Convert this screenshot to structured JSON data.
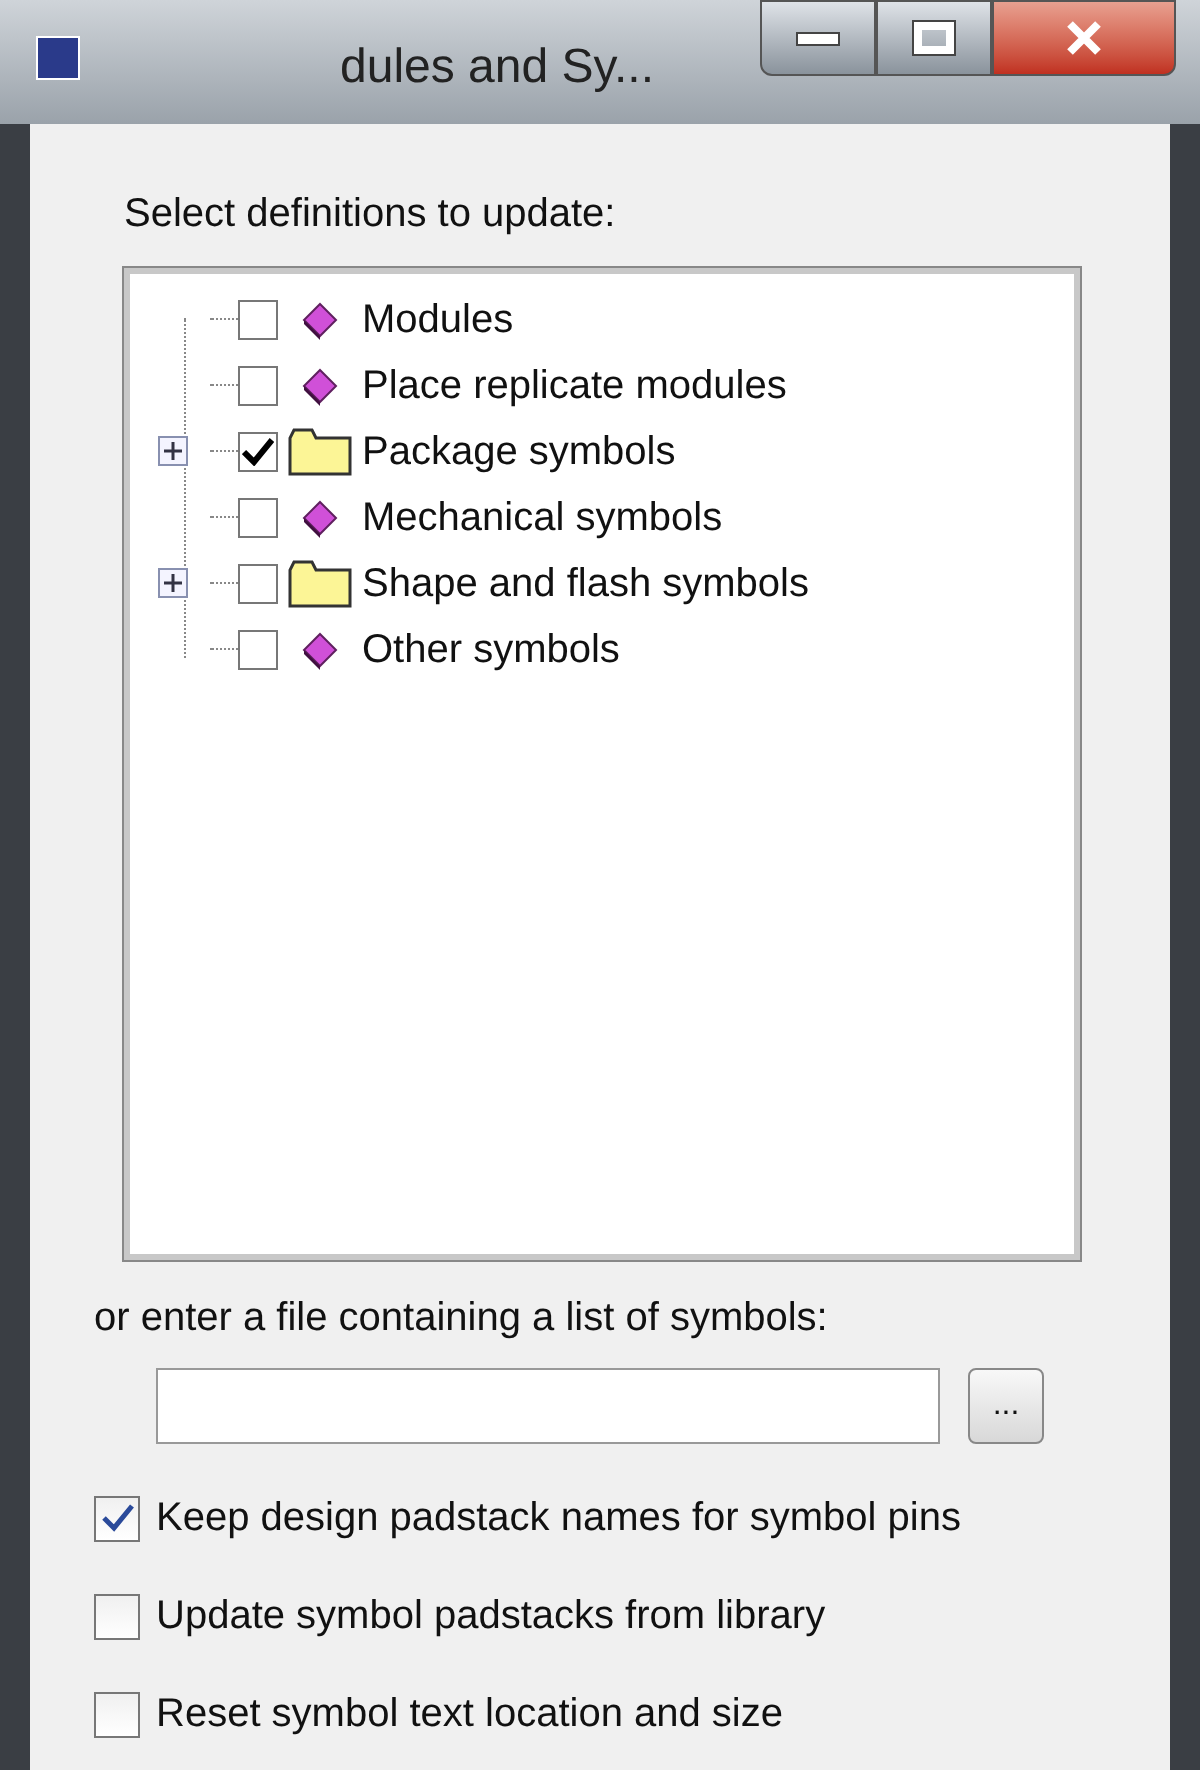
{
  "window": {
    "title": "dules and Sy..."
  },
  "tree": {
    "label": "Select definitions to update:",
    "items": [
      {
        "label": "Modules",
        "kind": "module",
        "checked": false
      },
      {
        "label": "Place replicate modules",
        "kind": "module",
        "checked": false
      },
      {
        "label": "Package symbols",
        "kind": "folder",
        "checked": true,
        "expanded": false
      },
      {
        "label": "Mechanical symbols",
        "kind": "module",
        "checked": false
      },
      {
        "label": "Shape and flash symbols",
        "kind": "folder",
        "checked": false,
        "expanded": false
      },
      {
        "label": "Other symbols",
        "kind": "module",
        "checked": false
      }
    ]
  },
  "file": {
    "label": "or enter a file containing a list of symbols:",
    "browse": "..."
  },
  "options": [
    {
      "label": "Keep design padstack names for symbol pins",
      "checked": true
    },
    {
      "label": "Update symbol padstacks from library",
      "checked": false
    },
    {
      "label": "Reset symbol text location and size",
      "checked": false
    }
  ]
}
